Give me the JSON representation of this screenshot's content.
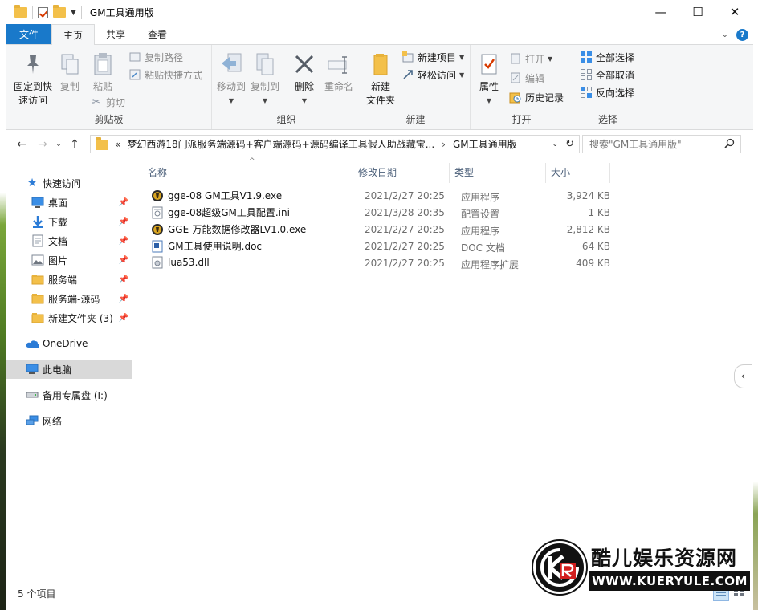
{
  "window": {
    "title": "GM工具通用版",
    "controls": {
      "minimize": "—",
      "maximize": "☐",
      "close": "✕"
    }
  },
  "ribbon_tabs": [
    "文件",
    "主页",
    "共享",
    "查看"
  ],
  "ribbon": {
    "clipboard": {
      "label": "剪贴板",
      "pin": "固定到快\n速访问",
      "copy": "复制",
      "paste": "粘贴",
      "copy_path": "复制路径",
      "paste_shortcut": "粘贴快捷方式",
      "cut": "剪切"
    },
    "organize": {
      "label": "组织",
      "move_to": "移动到",
      "copy_to": "复制到",
      "delete": "删除",
      "rename": "重命名"
    },
    "new": {
      "label": "新建",
      "new_folder": "新建\n文件夹",
      "new_item": "新建项目",
      "easy_access": "轻松访问"
    },
    "open": {
      "label": "打开",
      "properties": "属性",
      "open": "打开",
      "edit": "编辑",
      "history": "历史记录"
    },
    "select": {
      "label": "选择",
      "select_all": "全部选择",
      "select_none": "全部取消",
      "invert": "反向选择"
    }
  },
  "address": {
    "overflow": "«",
    "path": "梦幻西游18门派服务端源码+客户端源码+源码编译工具假人助战藏宝...",
    "current": "GM工具通用版"
  },
  "search": {
    "placeholder": "搜索\"GM工具通用版\""
  },
  "nav_pane": {
    "quick_access": "快速访问",
    "items": [
      {
        "label": "桌面",
        "icon": "desktop-icon"
      },
      {
        "label": "下载",
        "icon": "download-icon"
      },
      {
        "label": "文档",
        "icon": "document-icon"
      },
      {
        "label": "图片",
        "icon": "picture-icon"
      },
      {
        "label": "服务端",
        "icon": "folder-icon"
      },
      {
        "label": "服务端-源码",
        "icon": "folder-icon"
      },
      {
        "label": "新建文件夹 (3)",
        "icon": "folder-icon"
      }
    ],
    "onedrive": "OneDrive",
    "this_pc": "此电脑",
    "drive": "备用专属盘 (I:)",
    "network": "网络"
  },
  "columns": {
    "name": "名称",
    "date": "修改日期",
    "type": "类型",
    "size": "大小"
  },
  "files": [
    {
      "name": "gge-08 GM工具V1.9.exe",
      "date": "2021/2/27 20:25",
      "type": "应用程序",
      "size": "3,924 KB",
      "icon": "exe-icon"
    },
    {
      "name": "gge-08超级GM工具配置.ini",
      "date": "2021/3/28 20:35",
      "type": "配置设置",
      "size": "1 KB",
      "icon": "ini-icon"
    },
    {
      "name": "GGE-万能数据修改器LV1.0.exe",
      "date": "2021/2/27 20:25",
      "type": "应用程序",
      "size": "2,812 KB",
      "icon": "exe-icon"
    },
    {
      "name": "GM工具使用说明.doc",
      "date": "2021/2/27 20:25",
      "type": "DOC 文档",
      "size": "64 KB",
      "icon": "doc-icon"
    },
    {
      "name": "lua53.dll",
      "date": "2021/2/27 20:25",
      "type": "应用程序扩展",
      "size": "409 KB",
      "icon": "dll-icon"
    }
  ],
  "status": {
    "count": "5 个项目"
  },
  "watermark": {
    "title": "酷儿娱乐资源网",
    "url": "WWW.KUERYULE.COM"
  },
  "colors": {
    "accent": "#1979ca",
    "folder": "#f3c04a",
    "selected": "#d9d9d9"
  }
}
